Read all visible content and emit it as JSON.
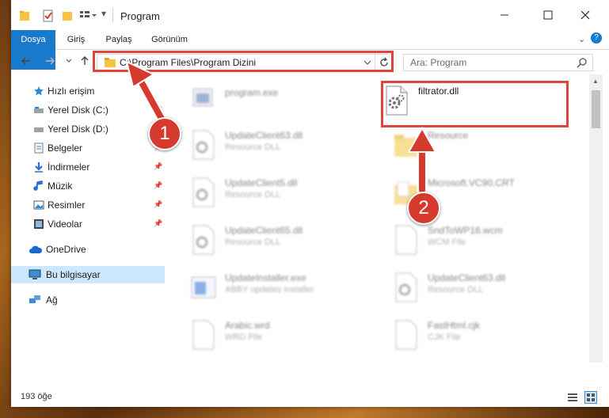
{
  "window": {
    "title": "Program"
  },
  "ribbon": {
    "tabs": [
      "Dosya",
      "Giriş",
      "Paylaş",
      "Görünüm"
    ]
  },
  "address": {
    "path": "C:\\Program Files\\Program Dizini"
  },
  "search": {
    "placeholder": "Ara: Program"
  },
  "sidebar": {
    "items": [
      {
        "label": "Hızlı erişim",
        "icon": "star-icon"
      },
      {
        "label": "Yerel Disk (C:)",
        "icon": "drive-icon"
      },
      {
        "label": "Yerel Disk (D:)",
        "icon": "drive-icon"
      },
      {
        "label": "Belgeler",
        "icon": "documents-icon"
      },
      {
        "label": "İndirmeler",
        "icon": "download-icon"
      },
      {
        "label": "Müzik",
        "icon": "music-icon"
      },
      {
        "label": "Resimler",
        "icon": "pictures-icon"
      },
      {
        "label": "Videolar",
        "icon": "video-icon"
      },
      {
        "label": "OneDrive",
        "icon": "cloud-icon"
      },
      {
        "label": "Bu bilgisayar",
        "icon": "computer-icon"
      },
      {
        "label": "Ağ",
        "icon": "network-icon"
      }
    ]
  },
  "files": [
    {
      "name": "program.exe",
      "type": ""
    },
    {
      "name": "filtrator.dll",
      "type": ""
    },
    {
      "name": "UpdateClient63.dll",
      "type": "Resource DLL"
    },
    {
      "name": "Resource",
      "type": ""
    },
    {
      "name": "UpdateClient5.dll",
      "type": "Resource DLL"
    },
    {
      "name": "Microsoft.VC90.CRT",
      "type": ""
    },
    {
      "name": "UpdateClient65.dll",
      "type": "Resource DLL"
    },
    {
      "name": "SndToWP16.wcm",
      "type": "WCM File"
    },
    {
      "name": "UpdateInstaller.exe",
      "type": "ABBY updates installer"
    },
    {
      "name": "UpdateClient63.dll",
      "type": "Resource DLL"
    },
    {
      "name": "Arabic.wrd",
      "type": "WRD File"
    },
    {
      "name": "FastHtml.cjk",
      "type": "CJK File"
    }
  ],
  "status": {
    "count": "193 öğe"
  },
  "annotations": {
    "step1": "1",
    "step2": "2"
  },
  "colors": {
    "accent": "#1979ca",
    "highlight": "#e0443a",
    "selected": "#cce8ff"
  }
}
